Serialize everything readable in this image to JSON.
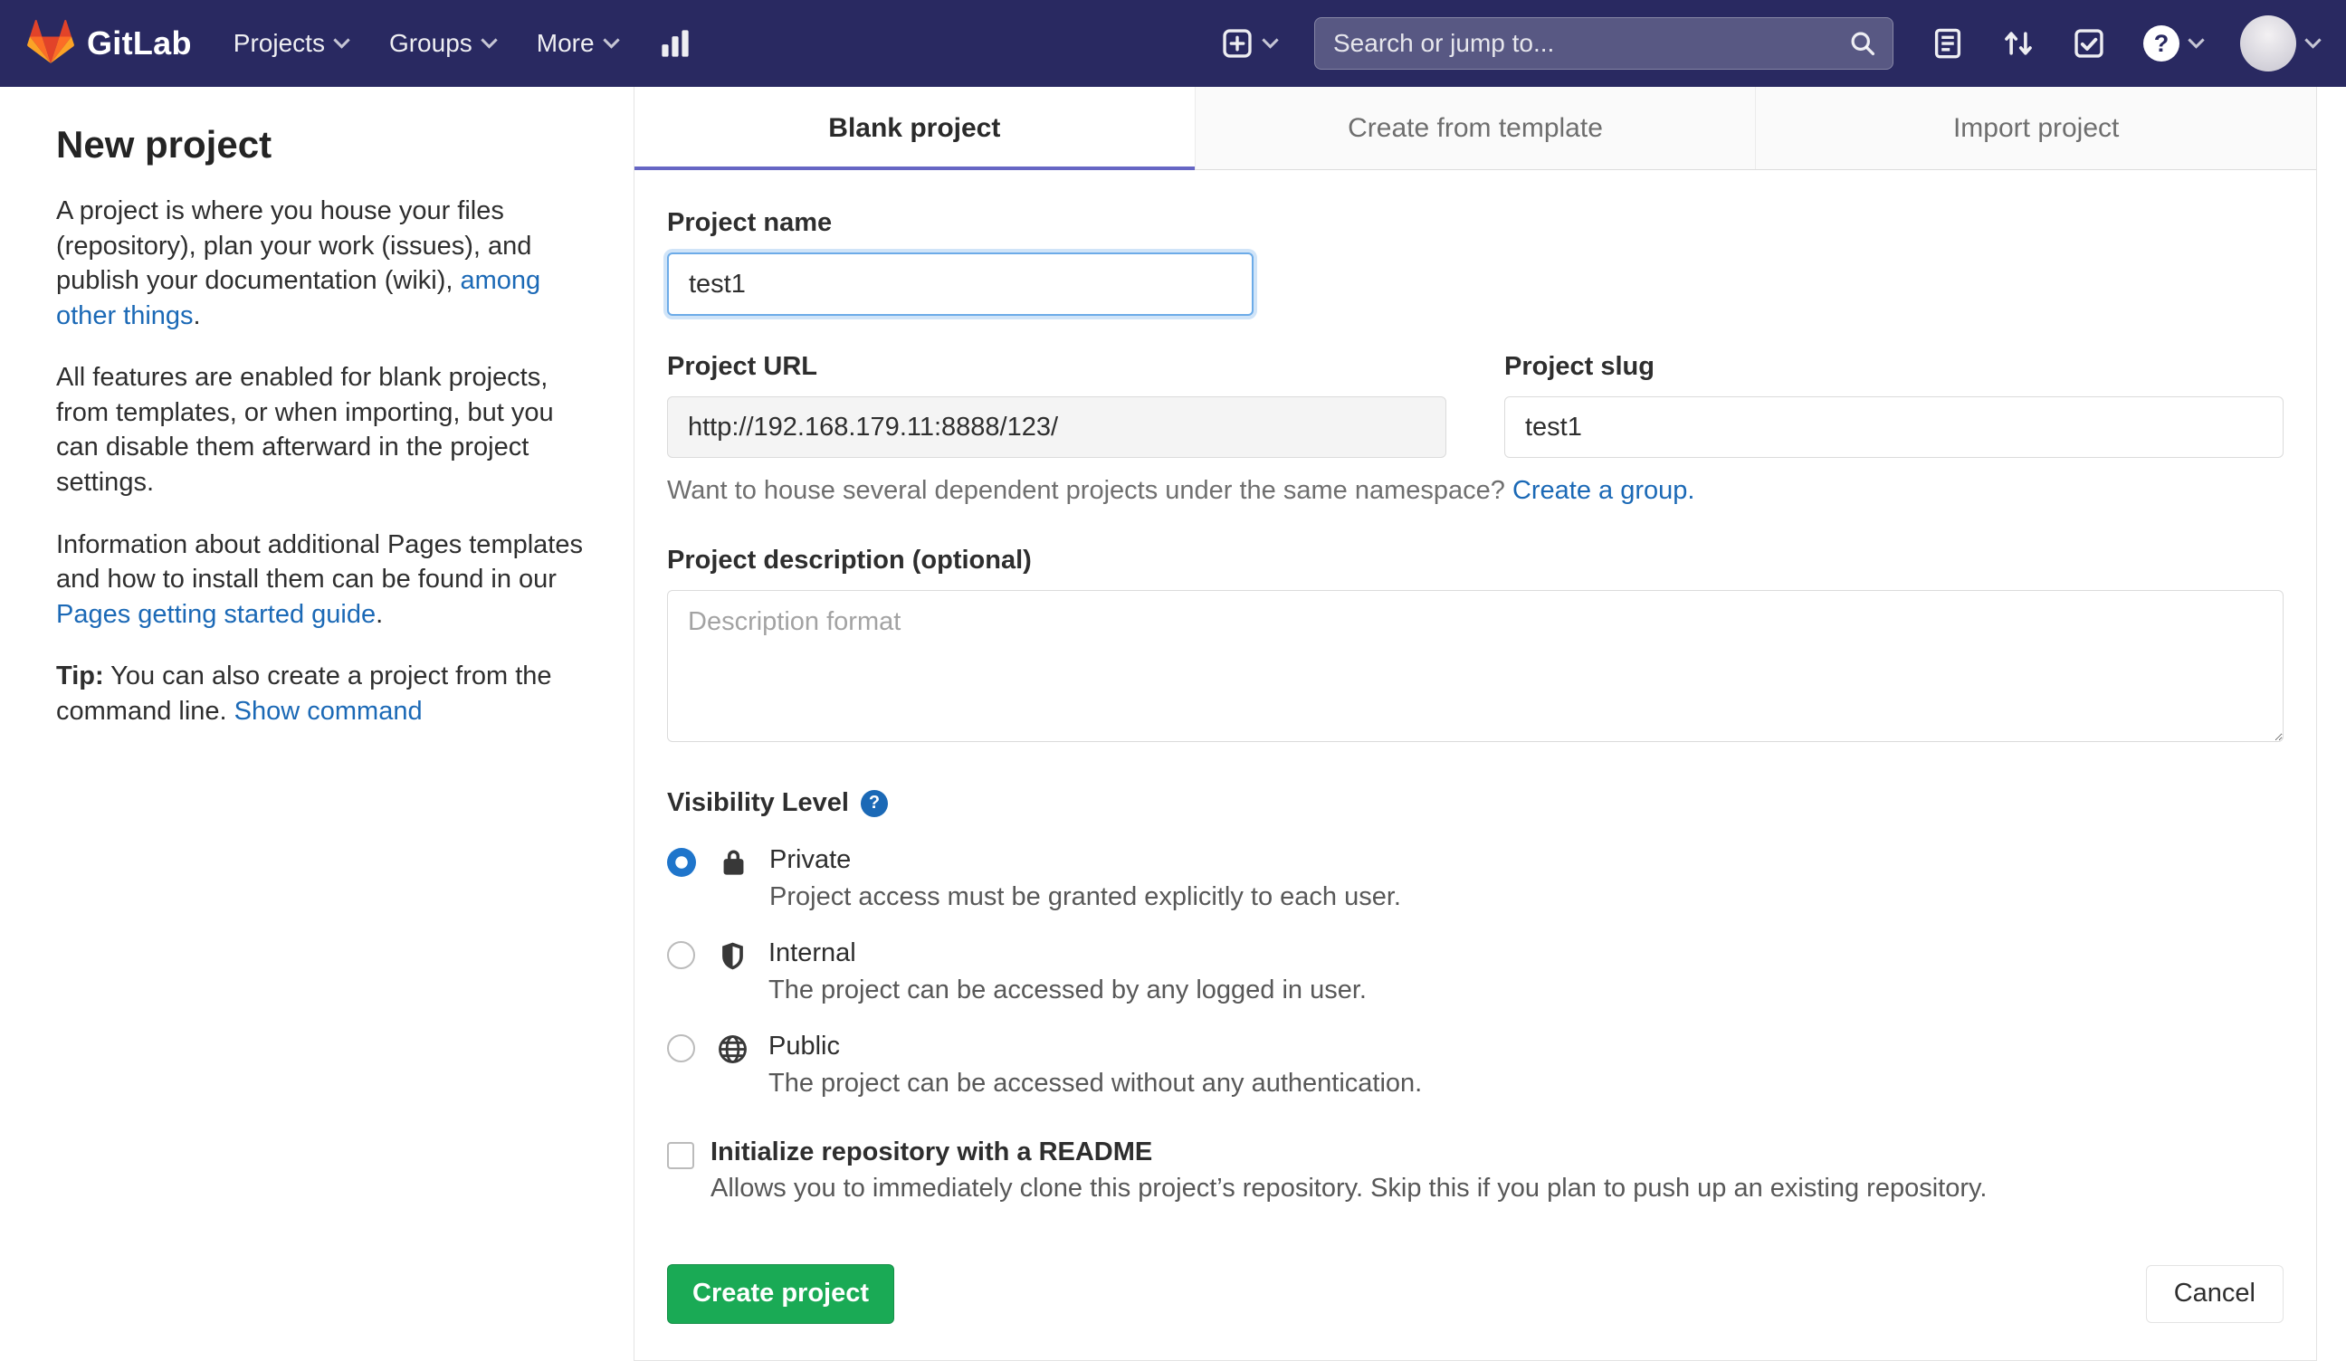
{
  "colors": {
    "navbar_bg": "#292961",
    "link_blue": "#1b69b6",
    "primary_green": "#1aaa55",
    "tab_indicator": "#6666c4",
    "radio_selected_blue": "#1f75cb"
  },
  "navbar": {
    "brand": "GitLab",
    "menu": [
      {
        "label": "Projects"
      },
      {
        "label": "Groups"
      },
      {
        "label": "More"
      }
    ],
    "search_placeholder": "Search or jump to...",
    "help_glyph": "?"
  },
  "sidebar": {
    "title": "New project",
    "para1_pre": "A project is where you house your files (repository), plan your work (issues), and publish your documentation (wiki), ",
    "para1_link": "among other things",
    "para1_post": ".",
    "para2": "All features are enabled for blank projects, from templates, or when importing, but you can disable them afterward in the project settings.",
    "para3_pre": "Information about additional Pages templates and how to install them can be found in our ",
    "para3_link": "Pages getting started guide",
    "para3_post": ".",
    "tip_label": "Tip:",
    "tip_text": "You can also create a project from the command line.",
    "tip_link": "Show command"
  },
  "tabs": [
    {
      "label": "Blank project",
      "active": true
    },
    {
      "label": "Create from template",
      "active": false
    },
    {
      "label": "Import project",
      "active": false
    }
  ],
  "form": {
    "project_name_label": "Project name",
    "project_name_value": "test1",
    "project_url_label": "Project URL",
    "project_url_value": "http://192.168.179.11:8888/123/",
    "project_slug_label": "Project slug",
    "project_slug_value": "test1",
    "namespace_hint": "Want to house several dependent projects under the same namespace?",
    "namespace_link": "Create a group.",
    "description_label": "Project description (optional)",
    "description_placeholder": "Description format",
    "visibility_label": "Visibility Level",
    "visibility_help_glyph": "?",
    "visibility_options": [
      {
        "name": "Private",
        "desc": "Project access must be granted explicitly to each user.",
        "selected": true
      },
      {
        "name": "Internal",
        "desc": "The project can be accessed by any logged in user.",
        "selected": false
      },
      {
        "name": "Public",
        "desc": "The project can be accessed without any authentication.",
        "selected": false
      }
    ],
    "readme_label": "Initialize repository with a README",
    "readme_desc": "Allows you to immediately clone this project’s repository. Skip this if you plan to push up an existing repository.",
    "create_button": "Create project",
    "cancel_button": "Cancel"
  }
}
